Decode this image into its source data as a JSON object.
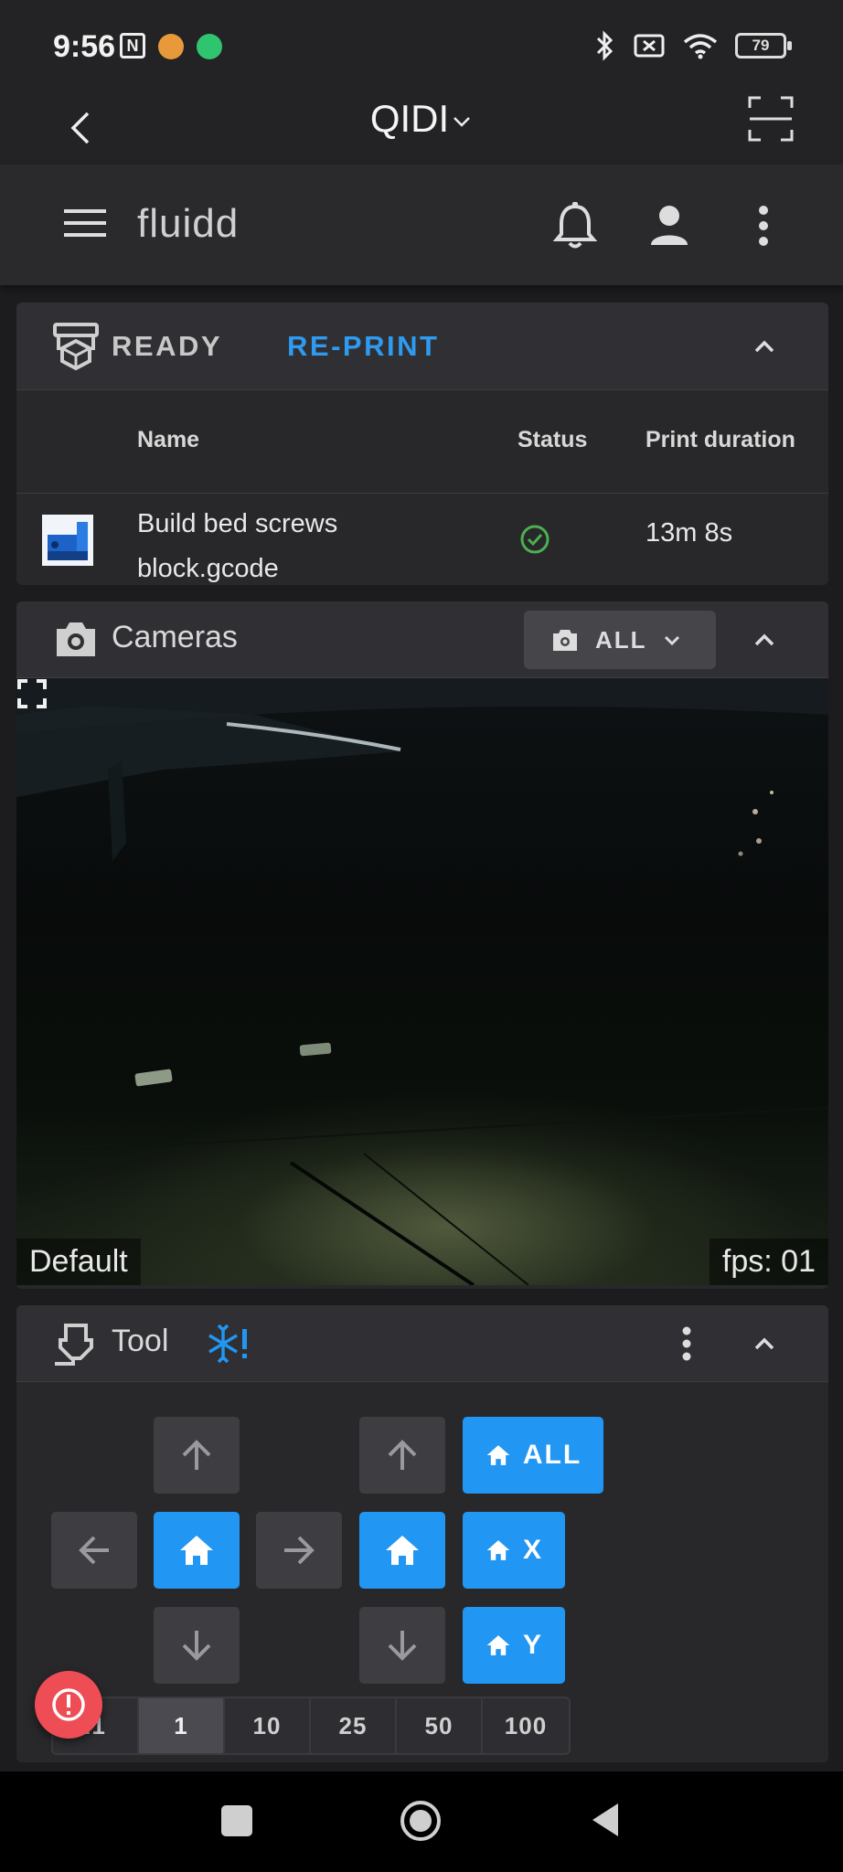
{
  "status_bar": {
    "time": "9:56",
    "nfc_glyph": "N",
    "battery": "79",
    "icons": [
      "nfc-icon",
      "notification-dot-icon",
      "shield-icon",
      "bluetooth-icon",
      "no-sim-icon",
      "wifi-icon",
      "battery-icon"
    ]
  },
  "app_bar": {
    "title": "QIDI",
    "icons": [
      "back-icon",
      "chevron-down-icon",
      "scan-icon"
    ]
  },
  "fluidd": {
    "brand": "fluidd",
    "icons": [
      "menu-icon",
      "bell-icon",
      "user-icon",
      "more-vert-icon"
    ]
  },
  "status_card": {
    "state": "READY",
    "reprint": "RE-PRINT",
    "columns": {
      "name": "Name",
      "status": "Status",
      "duration": "Print duration"
    },
    "jobs": [
      {
        "name_line1": "Build bed screws",
        "name_line2": "block.gcode",
        "status_icon": "check-circle-icon",
        "duration": "13m 8s"
      }
    ]
  },
  "cameras_card": {
    "title": "Cameras",
    "selector": "ALL",
    "camera_name": "Default",
    "fps": "fps: 01"
  },
  "tool_card": {
    "title": "Tool",
    "home_all": "ALL",
    "home_x": "X",
    "home_y": "Y",
    "steps": [
      ".1",
      "1",
      "10",
      "25",
      "50",
      "100"
    ],
    "active_step": "1"
  },
  "colors": {
    "accent": "#2196f3",
    "link": "#2e9bf0",
    "success": "#4caf50",
    "danger": "#ef4d55",
    "background": "#1c1c1e",
    "card": "#28282a"
  }
}
